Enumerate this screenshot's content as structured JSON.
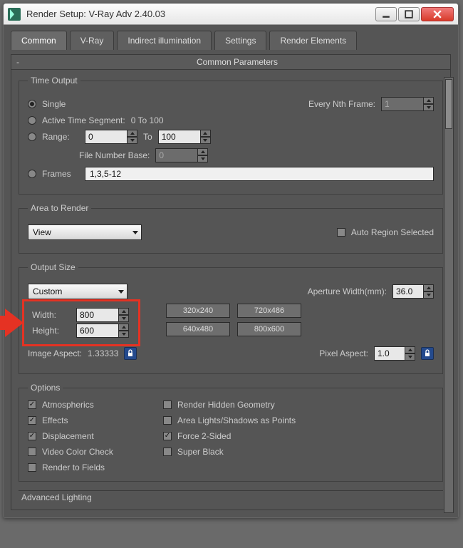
{
  "window": {
    "title": "Render Setup: V-Ray Adv 2.40.03"
  },
  "tabs": [
    "Common",
    "V-Ray",
    "Indirect illumination",
    "Settings",
    "Render Elements"
  ],
  "active_tab": 0,
  "rollup": {
    "title": "Common Parameters"
  },
  "time_output": {
    "legend": "Time Output",
    "single": "Single",
    "every_nth_label": "Every Nth Frame:",
    "every_nth_value": "1",
    "active_label": "Active Time Segment:",
    "active_range": "0 To 100",
    "range_label": "Range:",
    "range_from": "0",
    "range_to_label": "To",
    "range_to": "100",
    "file_num_label": "File Number Base:",
    "file_num_value": "0",
    "frames_label": "Frames",
    "frames_value": "1,3,5-12",
    "selected": "single"
  },
  "area": {
    "legend": "Area to Render",
    "selected": "View",
    "auto_region_label": "Auto Region Selected",
    "auto_region_checked": false
  },
  "output": {
    "legend": "Output Size",
    "preset_selected": "Custom",
    "aperture_label": "Aperture Width(mm):",
    "aperture_value": "36.0",
    "width_label": "Width:",
    "width_value": "800",
    "height_label": "Height:",
    "height_value": "600",
    "presets": [
      "320x240",
      "720x486",
      "640x480",
      "800x600"
    ],
    "image_aspect_label": "Image Aspect:",
    "image_aspect_value": "1.33333",
    "pixel_aspect_label": "Pixel Aspect:",
    "pixel_aspect_value": "1.0"
  },
  "options": {
    "legend": "Options",
    "items": [
      {
        "label": "Atmospherics",
        "checked": true
      },
      {
        "label": "Render Hidden Geometry",
        "checked": false
      },
      {
        "label": "Effects",
        "checked": true
      },
      {
        "label": "Area Lights/Shadows as Points",
        "checked": false
      },
      {
        "label": "Displacement",
        "checked": true
      },
      {
        "label": "Force 2-Sided",
        "checked": true
      },
      {
        "label": "Video Color Check",
        "checked": false
      },
      {
        "label": "Super Black",
        "checked": false
      },
      {
        "label": "Render to Fields",
        "checked": false
      }
    ]
  },
  "next_rollup": "Advanced Lighting"
}
